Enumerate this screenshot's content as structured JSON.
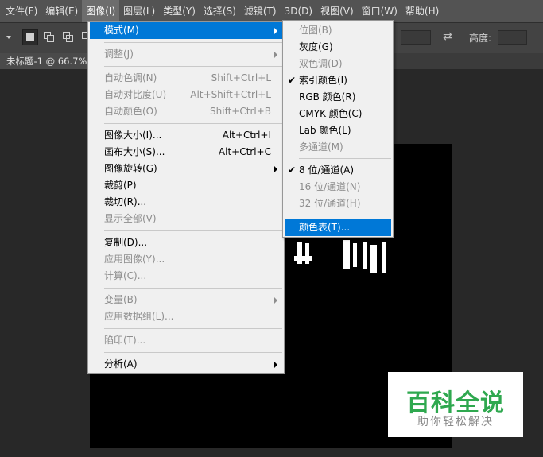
{
  "menubar": {
    "items": [
      "文件(F)",
      "编辑(E)",
      "图像(I)",
      "图层(L)",
      "类型(Y)",
      "选择(S)",
      "滤镜(T)",
      "3D(D)",
      "视图(V)",
      "窗口(W)",
      "帮助(H)"
    ]
  },
  "options_bar": {
    "height_label": "高度:"
  },
  "document_tab": {
    "title": "未标题-1 @ 66.7%"
  },
  "image_menu": {
    "items": [
      {
        "label": "模式(M)",
        "shortcut": "",
        "submenu": true,
        "highlighted": true,
        "disabled": false
      },
      {
        "label": "调整(J)",
        "shortcut": "",
        "submenu": true,
        "disabled": true
      },
      {
        "label": "自动色调(N)",
        "shortcut": "Shift+Ctrl+L",
        "disabled": true
      },
      {
        "label": "自动对比度(U)",
        "shortcut": "Alt+Shift+Ctrl+L",
        "disabled": true
      },
      {
        "label": "自动颜色(O)",
        "shortcut": "Shift+Ctrl+B",
        "disabled": true
      },
      {
        "label": "图像大小(I)...",
        "shortcut": "Alt+Ctrl+I",
        "disabled": false
      },
      {
        "label": "画布大小(S)...",
        "shortcut": "Alt+Ctrl+C",
        "disabled": false
      },
      {
        "label": "图像旋转(G)",
        "shortcut": "",
        "submenu": true,
        "disabled": false
      },
      {
        "label": "裁剪(P)",
        "shortcut": "",
        "disabled": false
      },
      {
        "label": "裁切(R)...",
        "shortcut": "",
        "disabled": false
      },
      {
        "label": "显示全部(V)",
        "shortcut": "",
        "disabled": true
      },
      {
        "label": "复制(D)...",
        "shortcut": "",
        "disabled": false
      },
      {
        "label": "应用图像(Y)...",
        "shortcut": "",
        "disabled": true
      },
      {
        "label": "计算(C)...",
        "shortcut": "",
        "disabled": true
      },
      {
        "label": "变量(B)",
        "shortcut": "",
        "submenu": true,
        "disabled": true
      },
      {
        "label": "应用数据组(L)...",
        "shortcut": "",
        "disabled": true
      },
      {
        "label": "陷印(T)...",
        "shortcut": "",
        "disabled": true
      },
      {
        "label": "分析(A)",
        "shortcut": "",
        "submenu": true,
        "disabled": false
      }
    ]
  },
  "mode_submenu": {
    "items": [
      {
        "label": "位图(B)",
        "disabled": true
      },
      {
        "label": "灰度(G)",
        "disabled": false
      },
      {
        "label": "双色调(D)",
        "disabled": true
      },
      {
        "label": "索引颜色(I)",
        "checked": true,
        "disabled": false
      },
      {
        "label": "RGB 颜色(R)",
        "disabled": false
      },
      {
        "label": "CMYK 颜色(C)",
        "disabled": false
      },
      {
        "label": "Lab 颜色(L)",
        "disabled": false
      },
      {
        "label": "多通道(M)",
        "disabled": true
      },
      {
        "label": "8 位/通道(A)",
        "checked": true,
        "disabled": false
      },
      {
        "label": "16 位/通道(N)",
        "disabled": true
      },
      {
        "label": "32 位/通道(H)",
        "disabled": true
      },
      {
        "label": "颜色表(T)...",
        "highlighted": true,
        "disabled": false
      }
    ]
  },
  "watermark": {
    "title": "百科全说",
    "subtitle": "助你轻松解决"
  },
  "colors": {
    "highlight": "#0078d7",
    "menu_bg": "#f0f0f0",
    "app_bg": "#535353",
    "watermark_green": "#2fa84f"
  }
}
